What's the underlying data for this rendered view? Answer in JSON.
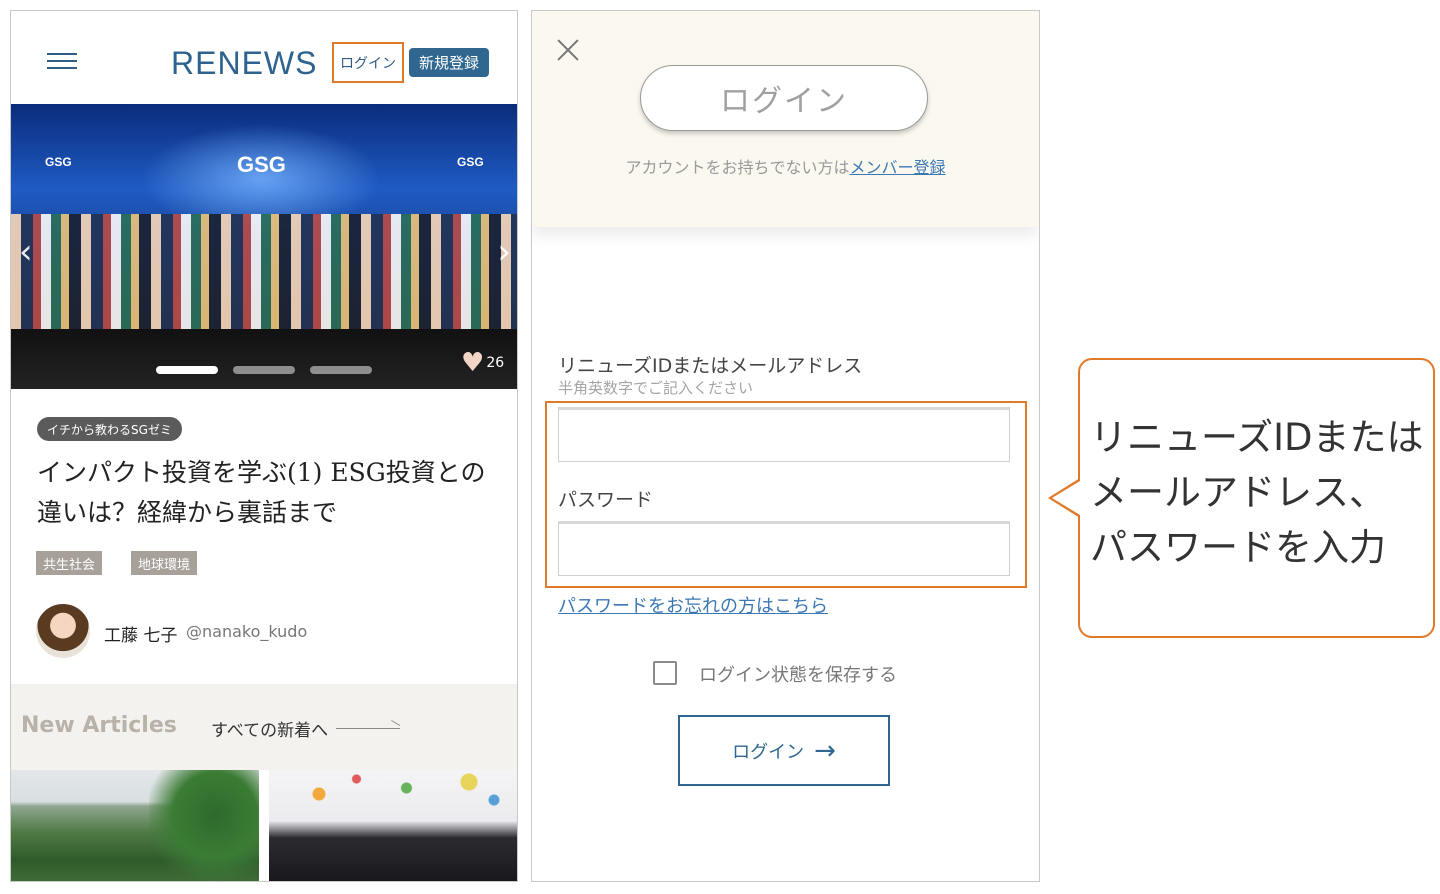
{
  "colors": {
    "accent_orange": "#e07a2b",
    "brand_blue": "#2f6790",
    "link_blue": "#3b78b3"
  },
  "left_panel": {
    "logo": "RENEWS",
    "header_login": "ログイン",
    "header_signup": "新規登録",
    "hero": {
      "sign_small_1": "GSG",
      "sign_main": "GSG",
      "sign_small_3": "GSG",
      "like_count": "26"
    },
    "article": {
      "category": "イチから教わるSGゼミ",
      "title": "インパクト投資を学ぶ(1) ESG投資との違いは？経緯から裏話まで",
      "tags": [
        "共生社会",
        "地球環境"
      ],
      "author_name": "工藤 七子",
      "author_handle": "@nanako_kudo"
    },
    "new_articles": {
      "heading": "New Articles",
      "all_link": "すべての新着へ"
    }
  },
  "login_panel": {
    "title": "ログイン",
    "no_account_text": "アカウントをお持ちでない方は",
    "member_signup_link": "メンバー登録",
    "id_label": "リニューズIDまたはメールアドレス",
    "id_hint": "半角英数字でご記入ください",
    "id_value": "",
    "password_label": "パスワード",
    "password_value": "",
    "forgot_link": "パスワードをお忘れの方はこちら",
    "remember_label": "ログイン状態を保存する",
    "remember_checked": false,
    "submit_label": "ログイン"
  },
  "callout": {
    "lines": [
      "リニューズIDまたは",
      "メールアドレス、",
      "パスワードを入力"
    ]
  }
}
